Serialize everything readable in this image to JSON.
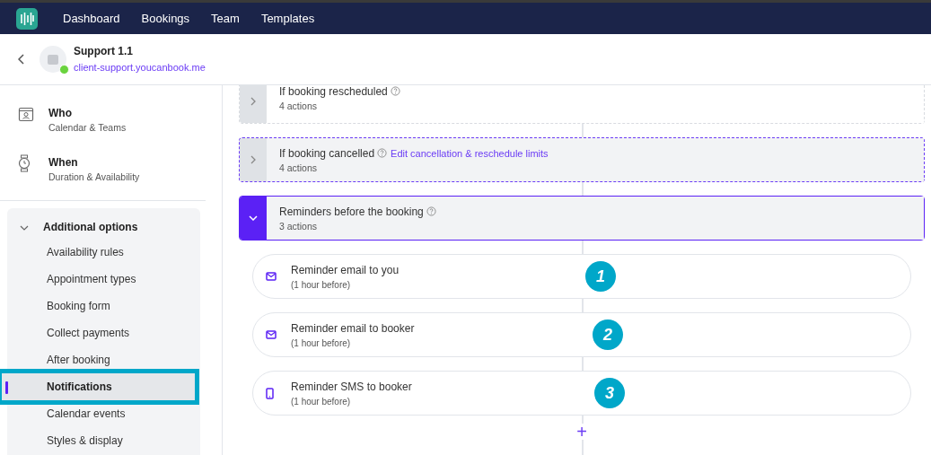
{
  "navbar": {
    "items": [
      {
        "label": "Dashboard"
      },
      {
        "label": "Bookings"
      },
      {
        "label": "Team"
      },
      {
        "label": "Templates"
      }
    ]
  },
  "header": {
    "title": "Support 1.1",
    "link": "client-support.youcanbook.me",
    "online": true
  },
  "sidebar": {
    "sections": [
      {
        "kind": "who",
        "title": "Who",
        "subtitle": "Calendar & Teams"
      },
      {
        "kind": "when",
        "title": "When",
        "subtitle": "Duration & Availability"
      }
    ],
    "group": {
      "title": "Additional options",
      "expanded": true,
      "items": [
        {
          "label": "Availability rules",
          "selected": false,
          "annotated": false
        },
        {
          "label": "Appointment types",
          "selected": false,
          "annotated": false
        },
        {
          "label": "Booking form",
          "selected": false,
          "annotated": false
        },
        {
          "label": "Collect payments",
          "selected": false,
          "annotated": false
        },
        {
          "label": "After booking",
          "selected": false,
          "annotated": false
        },
        {
          "label": "Notifications",
          "selected": true,
          "annotated": true
        },
        {
          "label": "Calendar events",
          "selected": false,
          "annotated": false
        },
        {
          "label": "Styles & display",
          "selected": false,
          "annotated": false
        }
      ]
    }
  },
  "workflows": [
    {
      "kind": "faded",
      "title": "If booking rescheduled",
      "count": "4 actions",
      "expanded": false
    },
    {
      "kind": "hovered",
      "title": "If booking cancelled",
      "count": "4 actions",
      "expanded": false,
      "link": "Edit cancellation & reschedule limits"
    },
    {
      "kind": "active",
      "title": "Reminders before the booking",
      "count": "3 actions",
      "expanded": true
    }
  ],
  "actions": [
    {
      "kind": "email",
      "title": "Reminder email to you",
      "timing": "(1 hour before)",
      "callout": "1"
    },
    {
      "kind": "email",
      "title": "Reminder email to booker",
      "timing": "(1 hour before)",
      "callout": "2"
    },
    {
      "kind": "sms",
      "title": "Reminder SMS to booker",
      "timing": "(1 hour before)",
      "callout": "3"
    }
  ],
  "add_button": {
    "label": "+"
  }
}
